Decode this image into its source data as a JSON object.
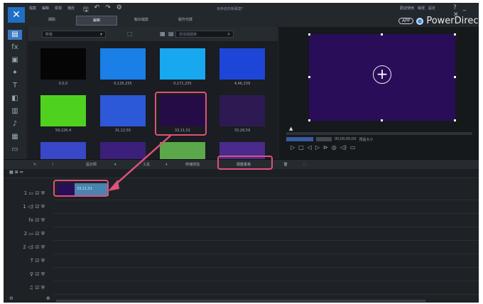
{
  "titlebar": {
    "logo_glyph": "✕",
    "menus": [
      "檔案",
      "編輯",
      "檢視",
      "播放"
    ],
    "project_name": "未命名的新專案*",
    "right_menus": [
      "歡迎使用",
      "帳號",
      "設定"
    ],
    "window_controls": "? _ ✕"
  },
  "modes": [
    {
      "label": "擷取"
    },
    {
      "label": "編輯",
      "active": true
    },
    {
      "label": "輸出檔案"
    },
    {
      "label": "製作光碟"
    }
  ],
  "brand": {
    "badge": "APP",
    "name": "PowerDirector"
  },
  "left_toolbar": {
    "items": [
      {
        "icon": "media-room-icon",
        "glyph": "▤",
        "active": true
      },
      {
        "icon": "effect-room-icon",
        "glyph": "fx"
      },
      {
        "icon": "pip-room-icon",
        "glyph": "▣"
      },
      {
        "icon": "particle-room-icon",
        "glyph": "✦"
      },
      {
        "icon": "title-room-icon",
        "glyph": "T"
      },
      {
        "icon": "transition-room-icon",
        "glyph": "◧"
      },
      {
        "icon": "audio-mixing-icon",
        "glyph": "▥"
      },
      {
        "icon": "voice-over-icon",
        "glyph": "♪"
      },
      {
        "icon": "chapter-room-icon",
        "glyph": "▦"
      },
      {
        "icon": "subtitle-room-icon",
        "glyph": "▭"
      }
    ]
  },
  "library": {
    "filter_value": "所有",
    "search_placeholder": "搜尋媒體庫",
    "swatches": [
      {
        "label": "0,0,0",
        "color": "#050505"
      },
      {
        "label": "0,126,255",
        "color": "#1a7fe6"
      },
      {
        "label": "0,171,255",
        "color": "#18a8f0"
      },
      {
        "label": "4,46,239",
        "color": "#1d46d8"
      },
      {
        "label": "59,226,4",
        "color": "#4fd11f"
      },
      {
        "label": "31,12,55",
        "color": "#2d58d8"
      },
      {
        "label": "33,11,51",
        "color": "#250c46"
      },
      {
        "label": "33,28,59",
        "color": "#2e1a52"
      },
      {
        "label": "",
        "color": "#3948c8"
      },
      {
        "label": "",
        "color": "#3c1f7a"
      },
      {
        "label": "",
        "color": "#5aa84a"
      },
      {
        "label": "",
        "color": "#4a2a8a"
      }
    ]
  },
  "preview": {
    "screen_color": "#2a0d58",
    "zoom_label": "適合",
    "timecode": "00;00;00;00",
    "quality_label": "預設大小"
  },
  "timeline_toolbar": {
    "buttons": [
      "設計師",
      "工具",
      "修補增強",
      "關鍵畫格"
    ],
    "highlighted_button": "關鍵畫格"
  },
  "tracks": [
    {
      "label": "1 ▭ ☑ ⛨",
      "icon": "video-track-icon"
    },
    {
      "label": "1 ◁) ☑ ⛨",
      "icon": "audio-track-icon"
    },
    {
      "label": "fx ☑ ⛨",
      "icon": "fx-track-icon"
    },
    {
      "label": "2 ▭ ☑ ⛨",
      "icon": "video-track-icon"
    },
    {
      "label": "2 ◁) ☑ ⛨",
      "icon": "audio-track-icon"
    },
    {
      "label": "T ☑ ⛨",
      "icon": "title-track-icon"
    },
    {
      "label": "♀ ☑ ⛨",
      "icon": "voice-track-icon"
    },
    {
      "label": "♫ ☑ ⛨",
      "icon": "music-track-icon"
    }
  ],
  "clip": {
    "label": "33,11,51",
    "color": "#4a84b0"
  },
  "colors": {
    "highlight": "#e0507a",
    "arrow": "#e0507a",
    "accent": "#3a78c0"
  }
}
